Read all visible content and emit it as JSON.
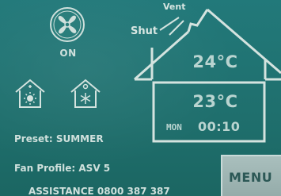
{
  "fan": {
    "icon": "fan-icon",
    "status": "ON"
  },
  "modes": {
    "summer_icon": "house-sun-icon",
    "winter_icon": "house-snowflake-icon"
  },
  "damper": {
    "vent_label": "Vent",
    "shut_label": "Shut"
  },
  "house": {
    "outdoor_temp": "24°C",
    "set_temp": "23°C",
    "day": "MON",
    "time": "00:10"
  },
  "info": {
    "preset": "Preset: SUMMER",
    "fan_profile": "Fan Profile: ASV 5",
    "assistance": "ASSISTANCE 0800 387 387"
  },
  "menu": {
    "label": "MENU"
  },
  "colors": {
    "background": "#1f716f",
    "text": "#cfe0dc",
    "menu_button": "#a3b9b7",
    "menu_text": "#2c5856"
  }
}
